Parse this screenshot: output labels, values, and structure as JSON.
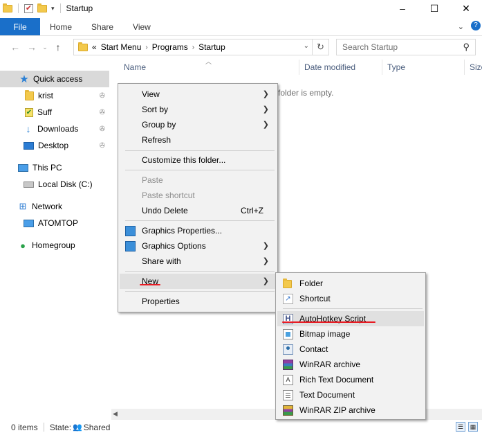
{
  "window": {
    "title": "Startup",
    "controls": [
      "–",
      "☐",
      "✕"
    ]
  },
  "ribbon": {
    "tabs": [
      "File",
      "Home",
      "Share",
      "View"
    ],
    "help": "?"
  },
  "address": {
    "prefix": "«",
    "crumbs": [
      "Start Menu",
      "Programs",
      "Startup"
    ],
    "search_placeholder": "Search Startup"
  },
  "nav": {
    "quick_access": "Quick access",
    "pinned": [
      "krist",
      "Suff",
      "Downloads",
      "Desktop"
    ],
    "this_pc": "This PC",
    "local_disk": "Local Disk (C:)",
    "network": "Network",
    "atomtop": "ATOMTOP",
    "homegroup": "Homegroup"
  },
  "columns": [
    "Name",
    "Date modified",
    "Type",
    "Size"
  ],
  "content": {
    "empty_text": "folder is empty."
  },
  "context_menu": {
    "view": "View",
    "sort_by": "Sort by",
    "group_by": "Group by",
    "refresh": "Refresh",
    "customize": "Customize this folder...",
    "paste": "Paste",
    "paste_shortcut": "Paste shortcut",
    "undo_delete": "Undo Delete",
    "undo_shortcut": "Ctrl+Z",
    "graphics_properties": "Graphics Properties...",
    "graphics_options": "Graphics Options",
    "share_with": "Share with",
    "new": "New",
    "properties": "Properties"
  },
  "new_submenu": {
    "folder": "Folder",
    "shortcut": "Shortcut",
    "ahk": "AutoHotkey Script",
    "bitmap": "Bitmap image",
    "contact": "Contact",
    "winrar": "WinRAR archive",
    "rtf": "Rich Text Document",
    "text": "Text Document",
    "winrar_zip": "WinRAR ZIP archive"
  },
  "status": {
    "items": "0 items",
    "state_label": "State:",
    "state_value": "Shared"
  },
  "colors": {
    "accent": "#1a6fc9",
    "annotation_red": "#e81b23"
  }
}
